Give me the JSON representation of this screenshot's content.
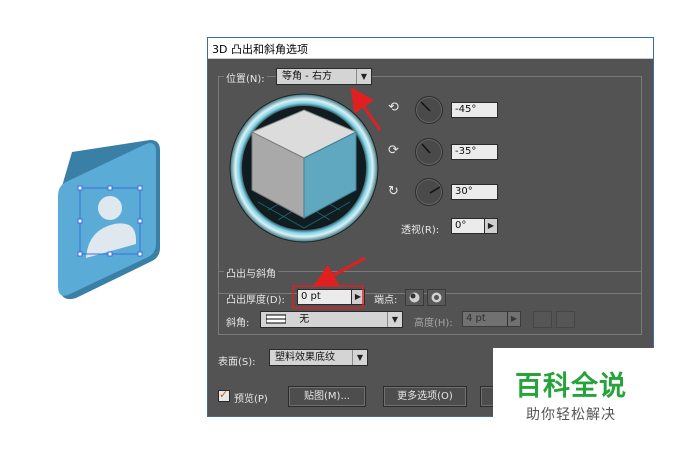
{
  "dialog": {
    "title": "3D 凸出和斜角选项",
    "position": {
      "label": "位置(N):",
      "preset": "等角 - 右方",
      "x_rotation": "-45°",
      "y_rotation": "-35°",
      "z_rotation": "30°",
      "perspective_label": "透视(R):",
      "perspective": "0°"
    },
    "extrude": {
      "section_title": "凸出与斜角",
      "depth_label": "凸出厚度(D):",
      "depth": "0 pt",
      "cap_label": "端点:",
      "bevel_label": "斜角:",
      "bevel": "无",
      "height_label": "高度(H):",
      "height": "4 pt"
    },
    "surface": {
      "label": "表面(S):",
      "value": "塑料效果底纹"
    },
    "buttons": {
      "preview": "预览(P)",
      "map_art": "贴图(M)...",
      "more_options": "更多选项(O)"
    }
  },
  "watermark": {
    "title": "百科全说",
    "subtitle": "助你轻松解决"
  },
  "colors": {
    "dialog_bg": "#535353",
    "cube_right_face": "#5fa8bf",
    "artwork_blue": "#4a9cc6",
    "arrow_red": "#e02020",
    "watermark_green": "#27a33c"
  }
}
